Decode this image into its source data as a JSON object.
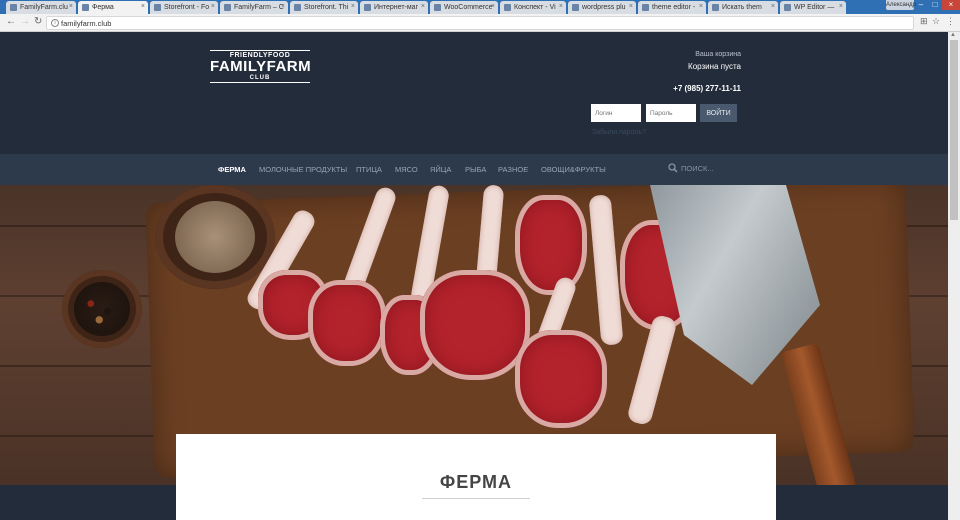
{
  "browser": {
    "tabs": [
      {
        "title": "FamilyFarm.clu",
        "active": false
      },
      {
        "title": "Ферма",
        "active": true
      },
      {
        "title": "Storefront - Fo",
        "active": false
      },
      {
        "title": "FamilyFarm – C",
        "active": false
      },
      {
        "title": "Storefront. Thi",
        "active": false
      },
      {
        "title": "Интернет-маг",
        "active": false
      },
      {
        "title": "WooCommerce",
        "active": false
      },
      {
        "title": "Конспект - Vi",
        "active": false
      },
      {
        "title": "wordpress plu",
        "active": false
      },
      {
        "title": "theme editor -",
        "active": false
      },
      {
        "title": "Искать them",
        "active": false
      },
      {
        "title": "WP Editor —",
        "active": false
      }
    ],
    "user_label": "Александр",
    "url": "familyfarm.club"
  },
  "logo": {
    "line1": "FRIENDLYFOOD",
    "line2": "FAMILYFARM",
    "line3": "CLUB"
  },
  "cart": {
    "title": "Ваша корзина",
    "status": "Корзина пуста"
  },
  "phone": "+7 (985) 277-11-11",
  "login": {
    "login_placeholder": "Логин",
    "password_placeholder": "Пароль",
    "submit_label": "ВОЙТИ",
    "forgot_label": "Забыли пароль?"
  },
  "nav": {
    "items": [
      {
        "label": "ФЕРМА",
        "active": true
      },
      {
        "label": "МОЛОЧНЫЕ ПРОДУКТЫ",
        "active": false
      },
      {
        "label": "ПТИЦА",
        "active": false
      },
      {
        "label": "МЯСО",
        "active": false
      },
      {
        "label": "ЯЙЦА",
        "active": false
      },
      {
        "label": "РЫБА",
        "active": false
      },
      {
        "label": "РАЗНОЕ",
        "active": false
      },
      {
        "label": "ОВОЩИ&ФРУКТЫ",
        "active": false
      }
    ],
    "search_placeholder": "ПОИСК..."
  },
  "page": {
    "title": "ФЕРМА"
  },
  "colors": {
    "header_bg": "#232c3a",
    "nav_bg": "#2c3a4b",
    "login_button_bg": "#4a596d"
  }
}
